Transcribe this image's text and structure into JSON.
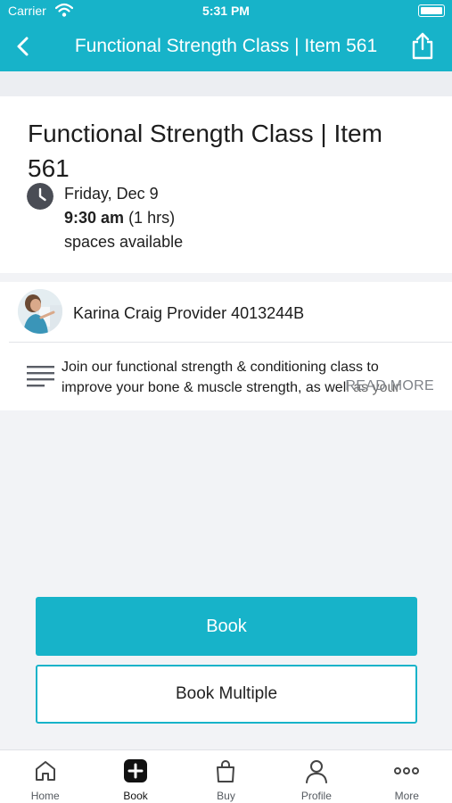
{
  "status_bar": {
    "carrier": "Carrier",
    "time": "5:31 PM"
  },
  "header": {
    "title": "Functional Strength Class | Item 561"
  },
  "class_info": {
    "title": "Functional Strength Class | Item 561",
    "date": "Friday, Dec 9",
    "time": "9:30 am",
    "duration": "(1 hrs)",
    "availability": "spaces available"
  },
  "provider": {
    "name": "Karina Craig Provider 4013244B",
    "description": "Join our functional strength & conditioning class to improve your bone & muscle strength, as well as your",
    "read_more_label": "READ MORE"
  },
  "actions": {
    "book_label": "Book",
    "book_multiple_label": "Book Multiple"
  },
  "tabs": [
    {
      "label": "Home",
      "icon": "home-icon"
    },
    {
      "label": "Book",
      "icon": "plus-square-icon"
    },
    {
      "label": "Buy",
      "icon": "shopping-bag-icon"
    },
    {
      "label": "Profile",
      "icon": "person-icon"
    },
    {
      "label": "More",
      "icon": "ellipsis-icon"
    }
  ],
  "colors": {
    "accent": "#17b3c9",
    "background": "#f2f3f6",
    "card": "#ffffff"
  }
}
